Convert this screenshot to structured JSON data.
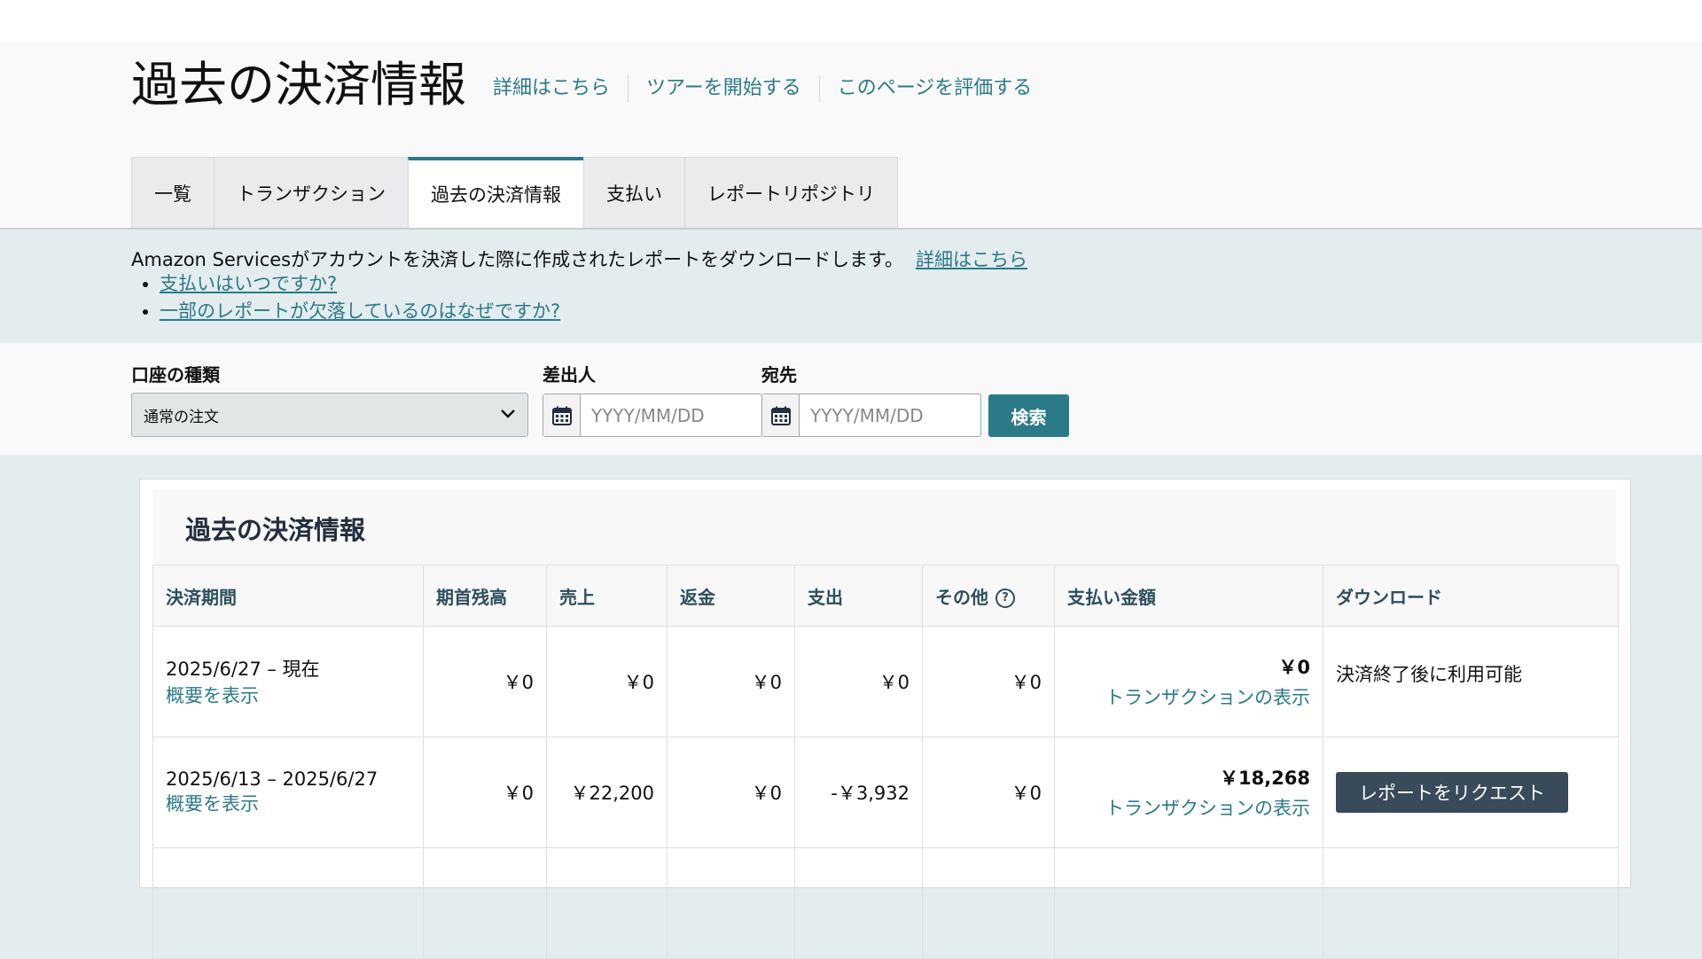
{
  "header": {
    "title": "過去の決済情報",
    "links": [
      "詳細はこちら",
      "ツアーを開始する",
      "このページを評価する"
    ]
  },
  "tabs": [
    {
      "label": "一覧",
      "active": false
    },
    {
      "label": "トランザクション",
      "active": false
    },
    {
      "label": "過去の決済情報",
      "active": true
    },
    {
      "label": "支払い",
      "active": false
    },
    {
      "label": "レポートリポジトリ",
      "active": false
    }
  ],
  "info": {
    "text": "Amazon Servicesがアカウントを決済した際に作成されたレポートをダウンロードします。",
    "link": "詳細はこちら",
    "bullets": [
      "支払いはいつですか?",
      "一部のレポートが欠落しているのはなぜですか?"
    ]
  },
  "filters": {
    "account_type_label": "口座の種類",
    "account_type_value": "通常の注文",
    "from_label": "差出人",
    "from_placeholder": "YYYY/MM/DD",
    "to_label": "宛先",
    "to_placeholder": "YYYY/MM/DD",
    "search_label": "検索"
  },
  "table": {
    "title": "過去の決済情報",
    "headers": [
      "決済期間",
      "期首残高",
      "売上",
      "返金",
      "支出",
      "その他",
      "支払い金額",
      "ダウンロード"
    ],
    "rows": [
      {
        "period": "2025/6/27 – 現在",
        "summary_link": "概要を表示",
        "opening": "￥0",
        "sales": "￥0",
        "refund": "￥0",
        "expense": "￥0",
        "other": "￥0",
        "payment": "￥0",
        "tx_link": "トランザクションの表示",
        "download_text": "決済終了後に利用可能",
        "download_button": ""
      },
      {
        "period": "2025/6/13 – 2025/6/27",
        "summary_link": "概要を表示",
        "opening": "￥0",
        "sales": "￥22,200",
        "refund": "￥0",
        "expense": "-￥3,932",
        "other": "￥0",
        "payment": "￥18,268",
        "tx_link": "トランザクションの表示",
        "download_text": "",
        "download_button": "レポートをリクエスト"
      }
    ]
  },
  "colors": {
    "accent": "#2b7a89",
    "info_band": "#e3ecee",
    "dark_button": "#394a5a"
  }
}
